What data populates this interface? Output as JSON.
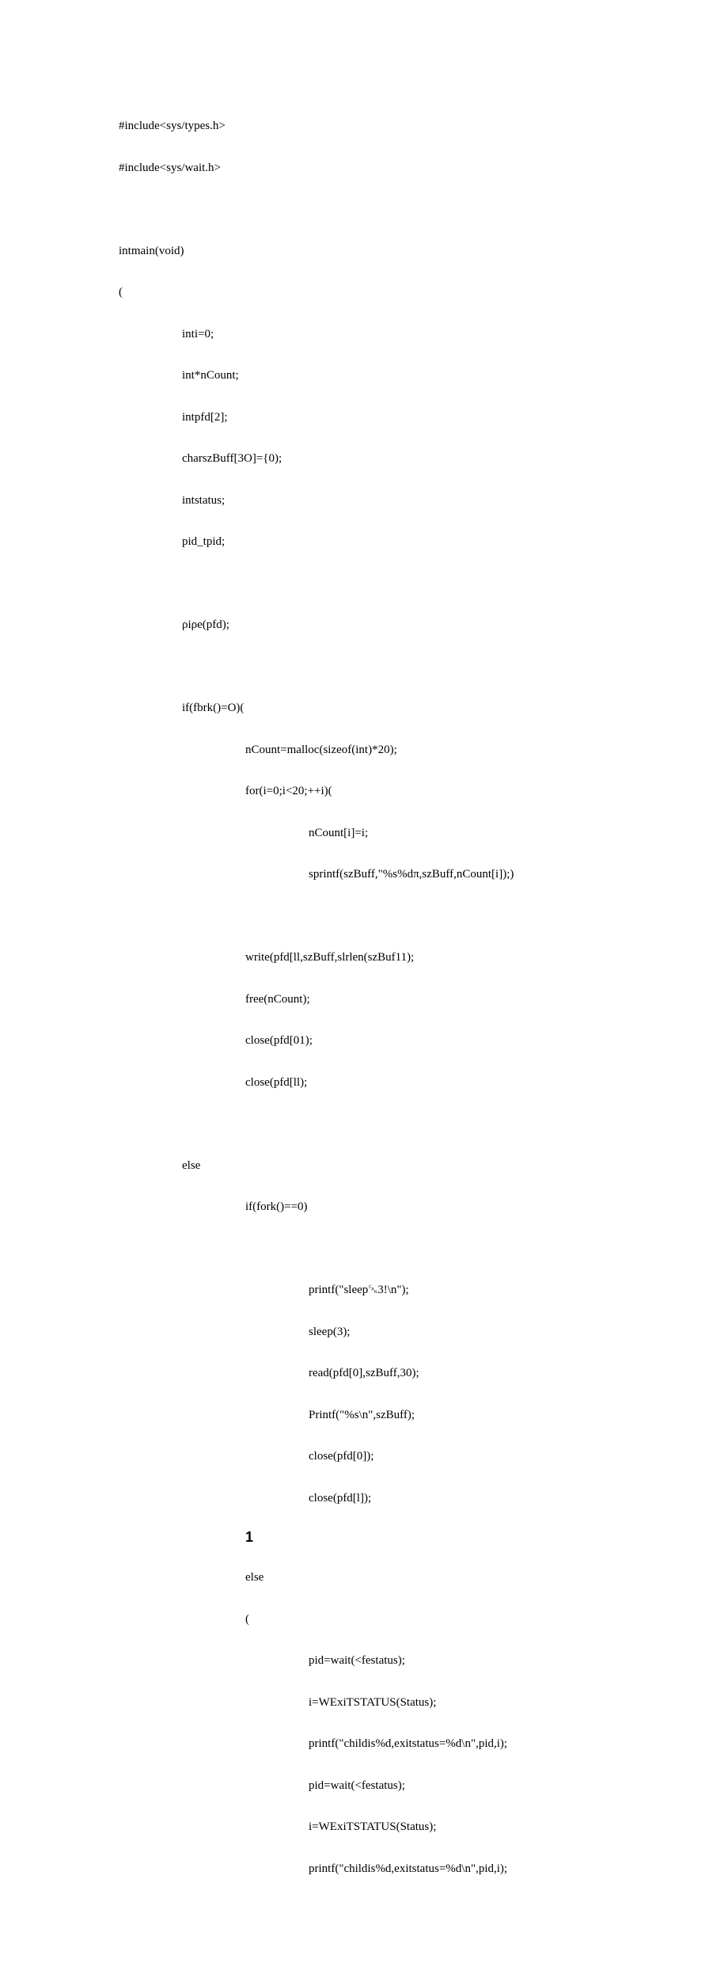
{
  "lines": {
    "l1": "#include<sys/types.h>",
    "l2": "#include<sys/wait.h>",
    "l3": "intmain(void)",
    "l4": "(",
    "l5": "inti=0;",
    "l6": "int*nCount;",
    "l7": "intpfd[2];",
    "l8": "charszBuff[3O]={0);",
    "l9": "intstatus;",
    "l10": "pid_tpid;",
    "l11": "ρiρe(pfd);",
    "l12": "if(fbrk()=O)(",
    "l13": "nCount=malloc(sizeof(int)*20);",
    "l14": "for(i=0;i<20;++i)(",
    "l15": "nCount[i]=i;",
    "l16": "sprintf(szBuff,\"%s%dπ,szBuff,nCount[i]);)",
    "l17": "write(pfd[ll,szBuff,slrlen(szBuf11);",
    "l18": "free(nCount);",
    "l19": "close(pfd[01);",
    "l20": "close(pfd[ll);",
    "l21": "else",
    "l22": "if(fork()==0)",
    "l23": "printf(\"sleep␘3!\\n\");",
    "l24": "sleep(3);",
    "l25": "read(pfd[0],szBuff,30);",
    "l26": "Printf(\"%s\\n\",szBuff);",
    "l27": "close(pfd[0]);",
    "l28": "close(pfd[l]);",
    "big1": "1",
    "l29": "else",
    "l30": "(",
    "l31": "pid=wait(<festatus);",
    "l32": "i=WExiTSTATUS(Status);",
    "l33": "printf(\"childis%d,exitstatus=%d\\n\",pid,i);",
    "l34": "pid=wait(<festatus);",
    "l35": "i=WExiTSTATUS(Status);",
    "l36": "printf(\"childis%d,exitstatus=%d\\n\",pid,i);"
  }
}
